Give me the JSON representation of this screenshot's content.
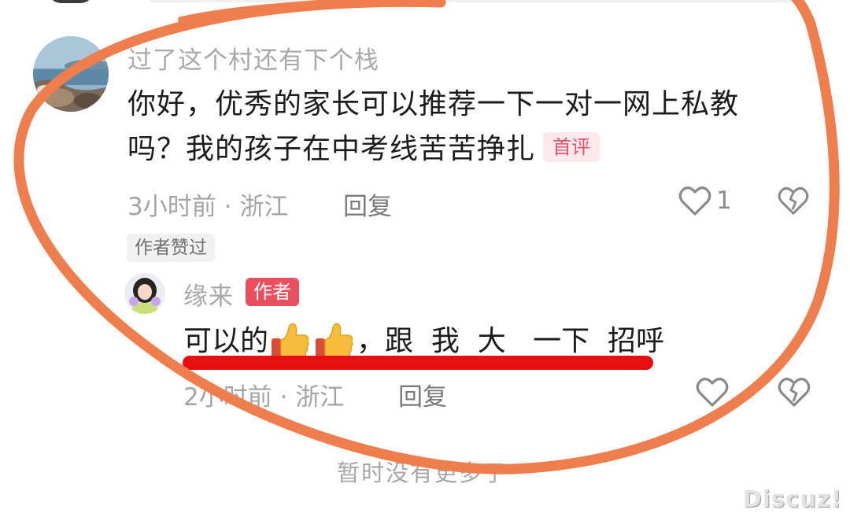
{
  "comment": {
    "username": "过了这个村还有下个栈",
    "text_line1": "你好，优秀的家长可以推荐一下一对一网上私教",
    "text_line2": "吗？我的孩子在中考线苦苦挣扎",
    "badge": "首评",
    "time": "3小时前",
    "location": "浙江",
    "reply_label": "回复",
    "like_count": "1",
    "author_liked_badge": "作者赞过"
  },
  "reply": {
    "username": "缘来",
    "author_badge": "作者",
    "text_part1": "可以的",
    "text_part2": "，跟  我  大   一下  招呼",
    "time": "2小时前",
    "location": "浙江",
    "reply_label": "回复"
  },
  "footer": {
    "no_more_text": "暂时没有更多了"
  },
  "watermark": "Discuz!",
  "colors": {
    "ring": "#ef7e4f",
    "underline": "#e80f10",
    "author_badge": "#e94f5c",
    "first_badge_text": "#e0536b"
  },
  "icons": {
    "like": "heart-outline-icon",
    "dislike": "broken-heart-icon",
    "emoji": "thumbs-up-emoji"
  }
}
